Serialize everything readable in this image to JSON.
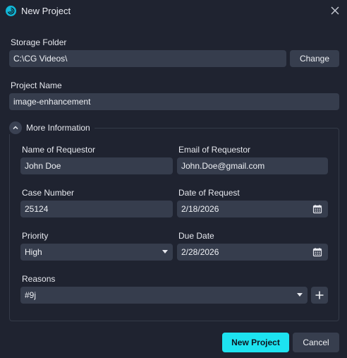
{
  "window": {
    "title": "New Project",
    "app_icon": "swirl-logo-icon",
    "close_icon": "close-icon"
  },
  "storage": {
    "label": "Storage Folder",
    "value": "C:\\CG Videos\\",
    "change_label": "Change"
  },
  "project_name": {
    "label": "Project Name",
    "value": "image-enhancement"
  },
  "more_info": {
    "header": "More Information",
    "requestor_name": {
      "label": "Name of Requestor",
      "value": "John Doe"
    },
    "requestor_email": {
      "label": "Email of Requestor",
      "value": "John.Doe@gmail.com"
    },
    "case_number": {
      "label": "Case Number",
      "value": "25124"
    },
    "date_of_request": {
      "label": "Date of Request",
      "value": "2/18/2026"
    },
    "priority": {
      "label": "Priority",
      "value": "High"
    },
    "due_date": {
      "label": "Due Date",
      "value": "2/28/2026"
    },
    "reasons": {
      "label": "Reasons",
      "value": "#9j"
    }
  },
  "footer": {
    "primary_label": "New Project",
    "cancel_label": "Cancel"
  },
  "colors": {
    "background": "#1f2330",
    "field": "#363d4d",
    "accent": "#1de3f0"
  }
}
